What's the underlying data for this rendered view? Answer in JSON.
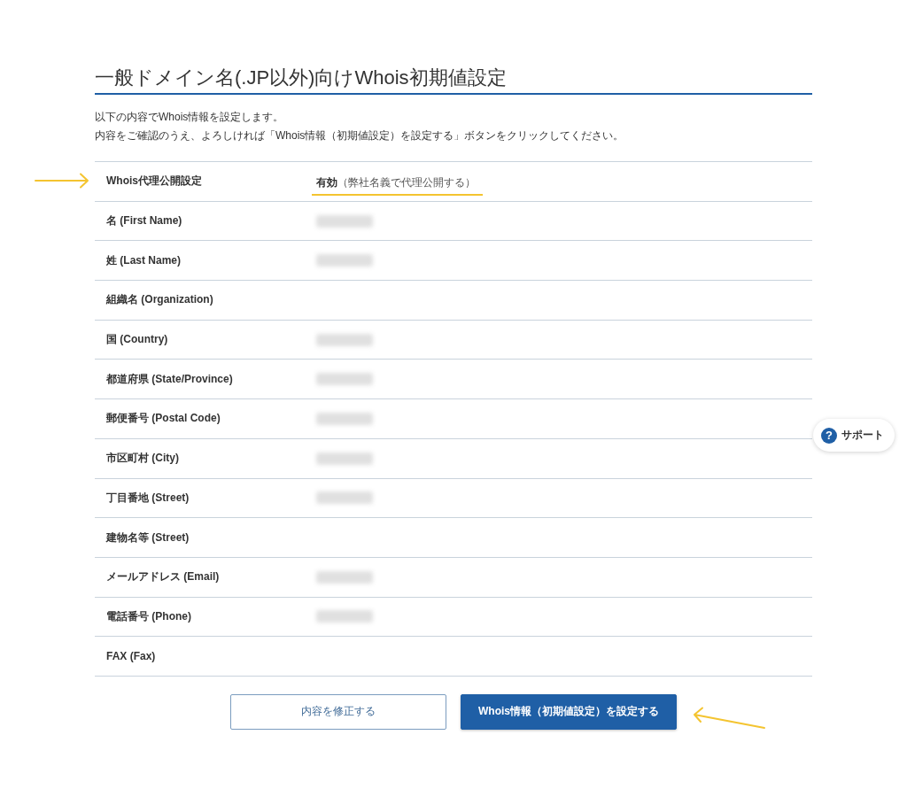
{
  "page": {
    "title": "一般ドメイン名(.JP以外)向けWhois初期値設定",
    "intro": [
      "以下の内容でWhois情報を設定します。",
      "内容をご確認のうえ、よろしければ「Whois情報（初期値設定）を設定する」ボタンをクリックしてください。"
    ]
  },
  "rows": [
    {
      "label": "Whois代理公開設定",
      "value": "**有効**（弊社名義で代理公開する）",
      "blurred": false,
      "highlighted": true
    },
    {
      "label": "名 (First Name)",
      "blurred": true,
      "highlighted": false
    },
    {
      "label": "姓 (Last Name)",
      "blurred": true,
      "highlighted": false
    },
    {
      "label": "組織名 (Organization)",
      "blurred": false,
      "highlighted": false
    },
    {
      "label": "国 (Country)",
      "blurred": true,
      "highlighted": false
    },
    {
      "label": "都道府県 (State/Province)",
      "blurred": true,
      "highlighted": false
    },
    {
      "label": "郵便番号 (Postal Code)",
      "blurred": true,
      "highlighted": false
    },
    {
      "label": "市区町村 (City)",
      "blurred": true,
      "highlighted": false
    },
    {
      "label": "丁目番地 (Street)",
      "blurred": true,
      "highlighted": false
    },
    {
      "label": "建物名等 (Street)",
      "blurred": false,
      "highlighted": false
    },
    {
      "label": "メールアドレス (Email)",
      "blurred": true,
      "highlighted": false
    },
    {
      "label": "電話番号 (Phone)",
      "blurred": true,
      "highlighted": false
    },
    {
      "label": "FAX (Fax)",
      "blurred": false,
      "highlighted": false
    }
  ],
  "buttons": [
    {
      "kind": "secondary",
      "label": "内容を修正する",
      "highlighted": false
    },
    {
      "kind": "primary",
      "label": "Whois情報（初期値設定）を設定する",
      "highlighted": true
    }
  ],
  "support": {
    "icon": "?",
    "label": "サポート"
  }
}
